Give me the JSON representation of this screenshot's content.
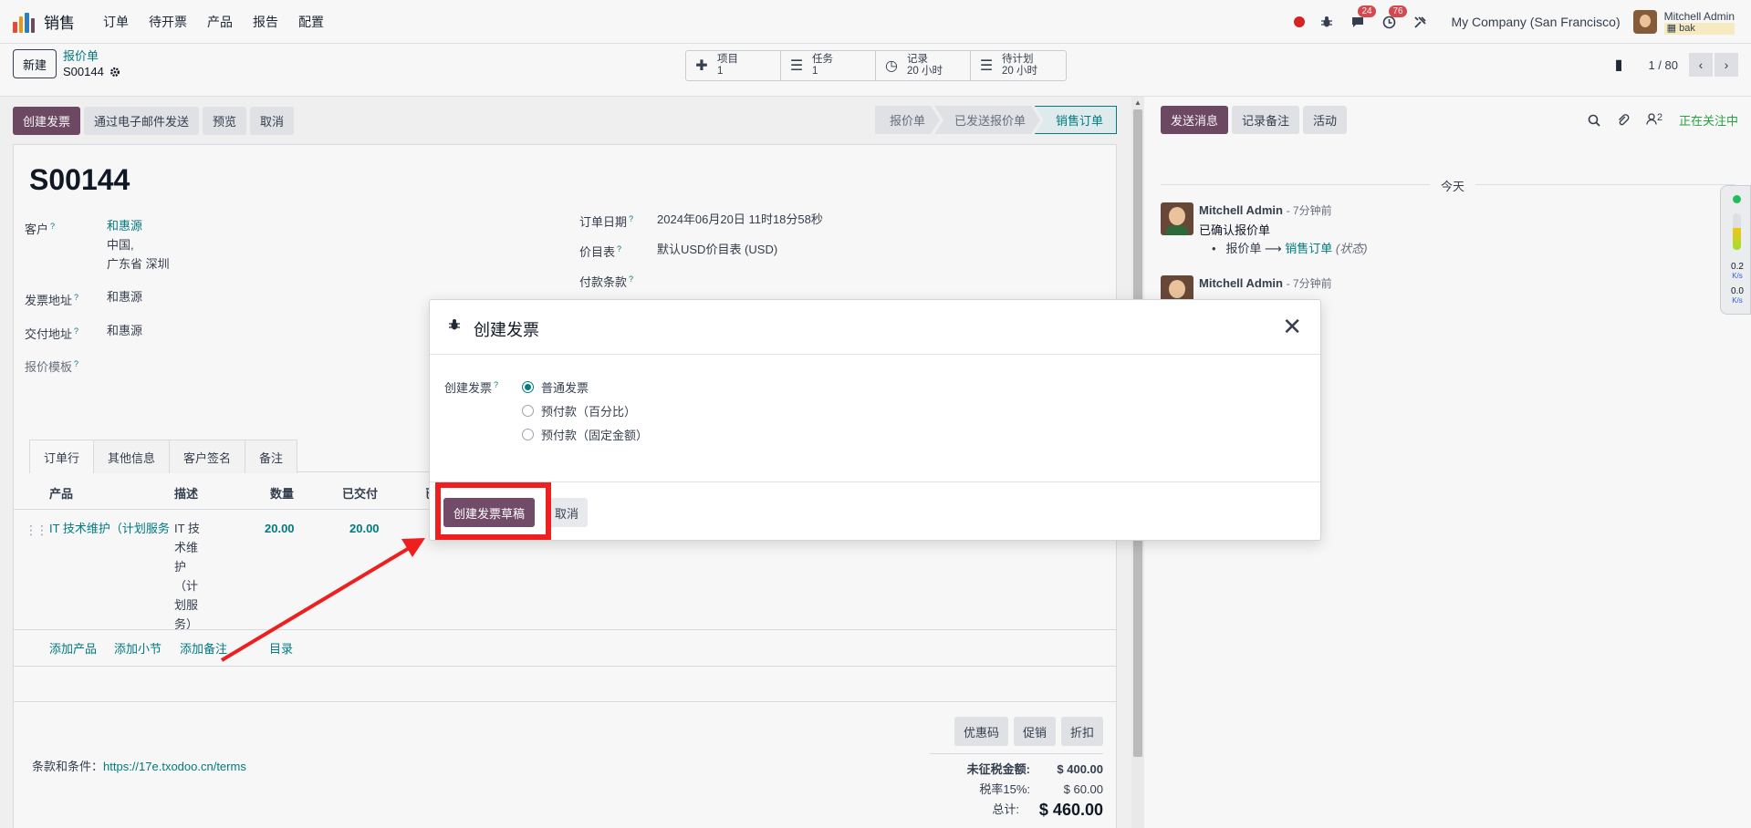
{
  "navbar": {
    "app_name": "销售",
    "menu": [
      "订单",
      "待开票",
      "产品",
      "报告",
      "配置"
    ],
    "chat_badge": "24",
    "activity_badge": "76",
    "company": "My Company (San Francisco)",
    "user_name": "Mitchell Admin",
    "user_db": "bak",
    "logo_colors": [
      "#e94e3c",
      "#f39c12",
      "#2f83c6",
      "#714b67"
    ]
  },
  "control_panel": {
    "new_label": "新建",
    "breadcrumb": "报价单",
    "record": "S00144",
    "smart_buttons": [
      {
        "icon": "puzzle-icon",
        "label": "项目",
        "value": "1"
      },
      {
        "icon": "tasks-icon",
        "label": "任务",
        "value": "1"
      },
      {
        "icon": "clock-icon",
        "label": "记录",
        "value": "20 小时"
      },
      {
        "icon": "tasks-icon",
        "label": "待计划",
        "value": "20 小时"
      }
    ],
    "pager": "1 / 80"
  },
  "statusbar": {
    "buttons": [
      "创建发票",
      "通过电子邮件发送",
      "预览",
      "取消"
    ],
    "stages": [
      "报价单",
      "已发送报价单",
      "销售订单"
    ],
    "active_stage": "销售订单"
  },
  "form": {
    "title": "S00144",
    "customer_label": "客户",
    "customer_name": "和惠源",
    "customer_addr1": "中国,",
    "customer_addr2": "广东省 深圳",
    "invoice_addr_label": "发票地址",
    "invoice_addr": "和惠源",
    "delivery_addr_label": "交付地址",
    "delivery_addr": "和惠源",
    "template_label": "报价模板",
    "order_date_label": "订单日期",
    "order_date": "2024年06月20日 11时18分58秒",
    "pricelist_label": "价目表",
    "pricelist": "默认USD价目表 (USD)",
    "payment_terms_label": "付款条款",
    "tabs": [
      "订单行",
      "其他信息",
      "客户签名",
      "备注"
    ],
    "columns": [
      "产品",
      "描述",
      "数量",
      "已交付",
      "已"
    ],
    "line": {
      "product": "IT 技术维护（计划服务",
      "desc_lines": [
        "IT 技",
        "术维",
        "护",
        "（计",
        "划服",
        "务）"
      ],
      "qty": "20.00",
      "delivered": "20.00"
    },
    "add_links": [
      "添加产品",
      "添加小节",
      "添加备注",
      "目录"
    ],
    "promo_buttons": [
      "优惠码",
      "促销",
      "折扣"
    ],
    "terms_label": "条款和条件：",
    "terms_url": "https://17e.txodoo.cn/terms",
    "untaxed_label": "未征税金额:",
    "untaxed": "$ 400.00",
    "tax_label": "税率15%:",
    "tax": "$ 60.00",
    "total_label": "总计:",
    "total": "$ 460.00"
  },
  "chatter": {
    "buttons": [
      "发送消息",
      "记录备注",
      "活动"
    ],
    "followers_count": "2",
    "following": "正在关注中",
    "today": "今天",
    "messages": [
      {
        "author": "Mitchell Admin",
        "ago": "- 7分钟前",
        "body": "已确认报价单",
        "track_from": "报价单",
        "track_to": "销售订单",
        "track_field": "(状态)"
      },
      {
        "author": "Mitchell Admin",
        "ago": "- 7分钟前"
      }
    ]
  },
  "side_widget": {
    "up": "0.2",
    "down": "0.0",
    "unit": "K/s"
  },
  "modal": {
    "title": "创建发票",
    "field_label": "创建发票",
    "options": [
      "普通发票",
      "预付款（百分比）",
      "预付款（固定金额）"
    ],
    "selected": "普通发票",
    "primary_button": "创建发票草稿",
    "cancel_button": "取消"
  },
  "annotation": {
    "color": "#ef1f1f"
  }
}
